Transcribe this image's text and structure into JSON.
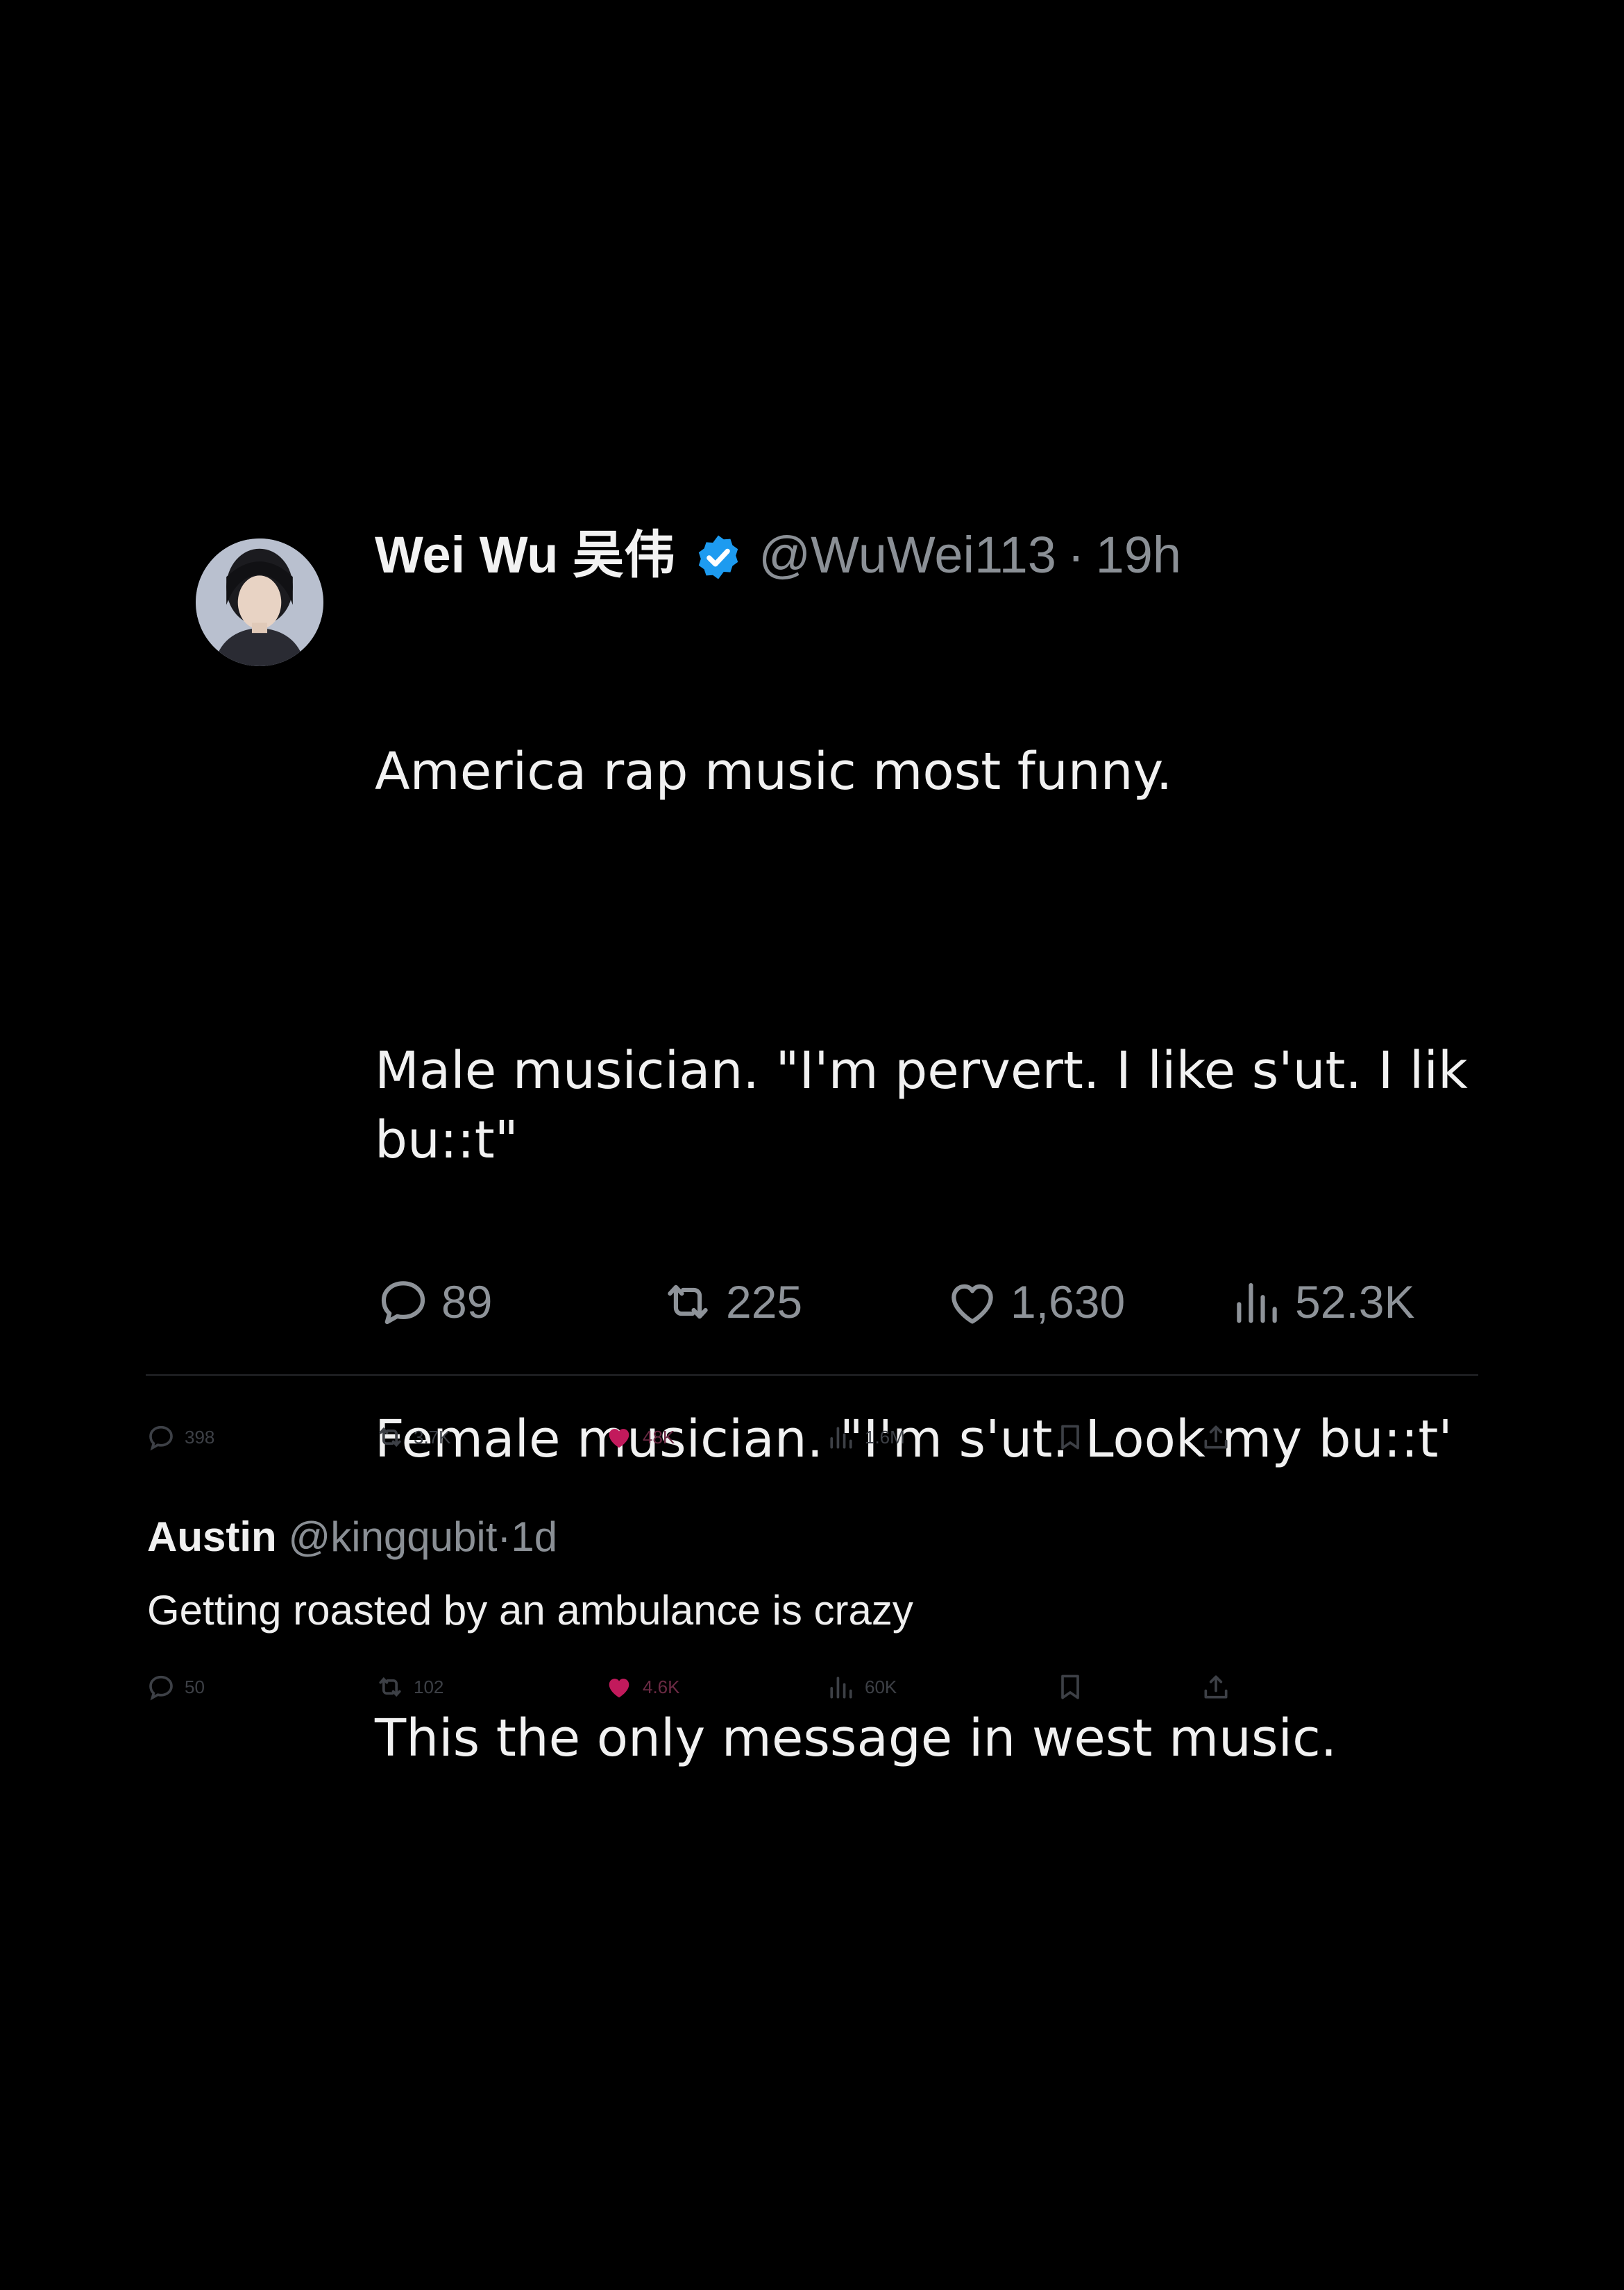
{
  "tweet": {
    "author": {
      "display_name": "Wei Wu 吴伟",
      "handle": "@WuWei113",
      "verified": true,
      "avatar_icon": "avatar-photo"
    },
    "time": "19h",
    "separator": "·",
    "paragraphs": [
      "America rap music most funny.",
      "Male musician. \"I'm pervert. I like s'ut. I lik\nbu::t\"",
      "Female musician. \"I'm s'ut. Look my bu::t'",
      "This the only message in west music."
    ],
    "stats": {
      "replies": "89",
      "retweets": "225",
      "likes": "1,630",
      "views": "52.3K"
    },
    "icons": {
      "reply": "reply-icon",
      "retweet": "retweet-icon",
      "like": "heart-icon",
      "views": "views-icon",
      "verified": "verified-badge-icon"
    },
    "colors": {
      "background": "#000000",
      "text": "#e7e9ea",
      "muted": "#8b9096",
      "verified": "#1d9bf0",
      "liked": "#f91880"
    }
  },
  "outer_bar_1": {
    "replies": "398",
    "retweets": "3.7K",
    "likes": "48K",
    "views": "1.6M"
  },
  "reply": {
    "display_name": "Austin",
    "handle": "@kingqubit",
    "separator": "·",
    "time": "1d",
    "text": "Getting roasted by an ambulance is crazy"
  },
  "outer_bar_2": {
    "replies": "50",
    "retweets": "102",
    "likes": "4.6K",
    "views": "60K"
  }
}
